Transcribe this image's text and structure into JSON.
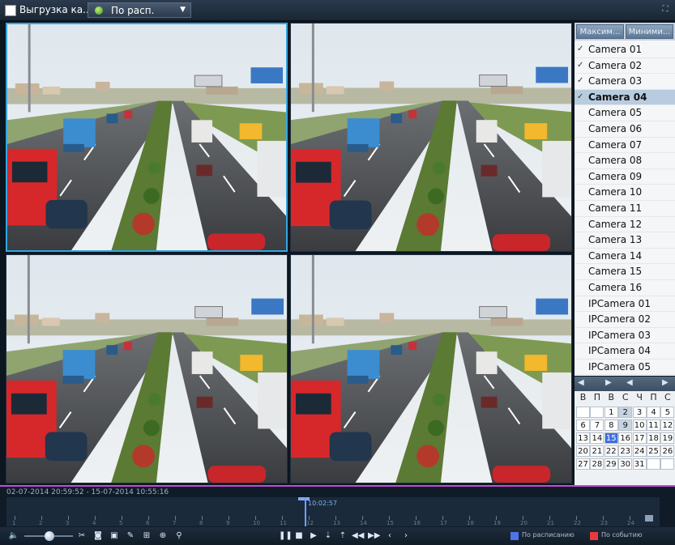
{
  "topbar": {
    "export_label": "Выгрузка ка...",
    "mode_label": "По расп.",
    "mode_icon": "status-dot-icon",
    "fullscreen_icon": "fullscreen-icon"
  },
  "panel": {
    "tabs": [
      "Максим...",
      "Миними..."
    ],
    "cameras": [
      {
        "label": "Camera 01",
        "checked": true
      },
      {
        "label": "Camera 02",
        "checked": true
      },
      {
        "label": "Camera 03",
        "checked": true
      },
      {
        "label": "Camera 04",
        "checked": true,
        "active": true
      },
      {
        "label": "Camera 05",
        "checked": false
      },
      {
        "label": "Camera 06",
        "checked": false
      },
      {
        "label": "Camera 07",
        "checked": false
      },
      {
        "label": "Camera 08",
        "checked": false
      },
      {
        "label": "Camera 09",
        "checked": false
      },
      {
        "label": "Camera 10",
        "checked": false
      },
      {
        "label": "Camera 11",
        "checked": false
      },
      {
        "label": "Camera 12",
        "checked": false
      },
      {
        "label": "Camera 13",
        "checked": false
      },
      {
        "label": "Camera 14",
        "checked": false
      },
      {
        "label": "Camera 15",
        "checked": false
      },
      {
        "label": "Camera 16",
        "checked": false
      },
      {
        "label": "IPCamera 01",
        "checked": false
      },
      {
        "label": "IPCamera 02",
        "checked": false
      },
      {
        "label": "IPCamera 03",
        "checked": false
      },
      {
        "label": "IPCamera 04",
        "checked": false
      },
      {
        "label": "IPCamera 05",
        "checked": false
      }
    ]
  },
  "calendar": {
    "weekdays": [
      "В",
      "П",
      "В",
      "С",
      "Ч",
      "П",
      "С"
    ],
    "weeks": [
      [
        "",
        "",
        "1",
        "2",
        "3",
        "4",
        "5"
      ],
      [
        "6",
        "7",
        "8",
        "9",
        "10",
        "11",
        "12"
      ],
      [
        "13",
        "14",
        "15",
        "16",
        "17",
        "18",
        "19"
      ],
      [
        "20",
        "21",
        "22",
        "23",
        "24",
        "25",
        "26"
      ],
      [
        "27",
        "28",
        "29",
        "30",
        "31",
        "",
        ""
      ]
    ],
    "recorded_days": [
      "2",
      "9",
      "15"
    ],
    "selected_day": "15"
  },
  "timeline": {
    "range_text": "02-07-2014 20:59:52 - 15-07-2014 10:55:16",
    "cursor_time": "10:02:57",
    "hour_labels": [
      "1",
      "2",
      "3",
      "4",
      "5",
      "6",
      "7",
      "8",
      "9",
      "10",
      "11",
      "12",
      "13",
      "14",
      "15",
      "16",
      "17",
      "18",
      "19",
      "20",
      "21",
      "22",
      "23",
      "24"
    ]
  },
  "controls": {
    "legend": [
      {
        "label": "По расписанию",
        "color": "#4f72e8"
      },
      {
        "label": "По событию",
        "color": "#e83a3a"
      }
    ]
  },
  "colors": {
    "selected_border": "#33a6e0",
    "timeline_accent": "#c64ad8",
    "calendar_selected": "#3f6ee0"
  }
}
